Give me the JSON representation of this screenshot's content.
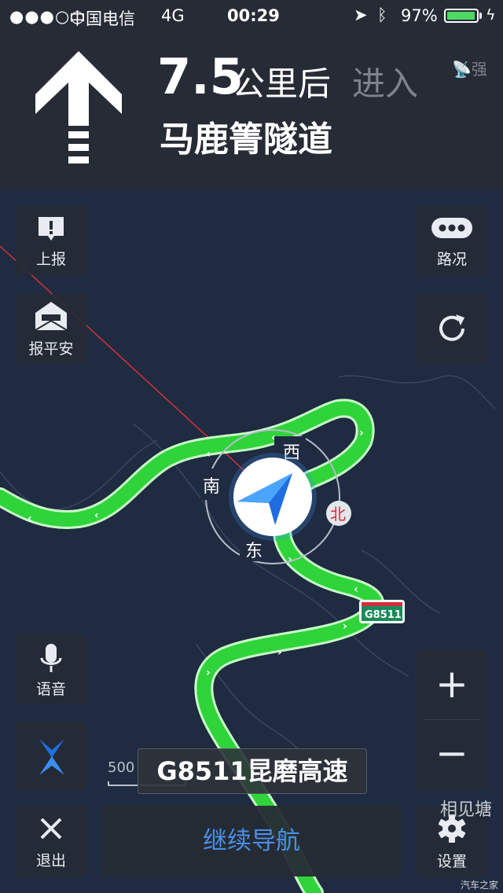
{
  "status_bar": {
    "signal": "●●●○○",
    "carrier": "中国电信",
    "network": "4G",
    "time": "00:29",
    "battery_percent": "97%",
    "battery_level": 0.97
  },
  "nav_header": {
    "distance": "7.5",
    "distance_unit": "公里后",
    "action": "进入",
    "road_name": "马鹿箐隧道",
    "gps_strength": "强"
  },
  "buttons": {
    "report": "上报",
    "traffic": "路况",
    "safe_report": "报平安",
    "voice": "语音",
    "exit": "退出",
    "settings": "设置",
    "continue_nav": "继续导航",
    "zoom_in": "+",
    "zoom_out": "−"
  },
  "compass": {
    "west": "西",
    "south": "南",
    "east": "东",
    "north": "北"
  },
  "map": {
    "highway_shield": "G8511",
    "current_road": "G8511昆磨高速",
    "scale_label": "500",
    "place_name": "相见塘"
  },
  "colors": {
    "route": "#2fd33a",
    "route_border": "#c9ffc9",
    "accent_blue": "#3a8ef0",
    "map_bg": "#1f2b40",
    "panel_bg": "#262b35"
  },
  "watermark": "汽车之家"
}
